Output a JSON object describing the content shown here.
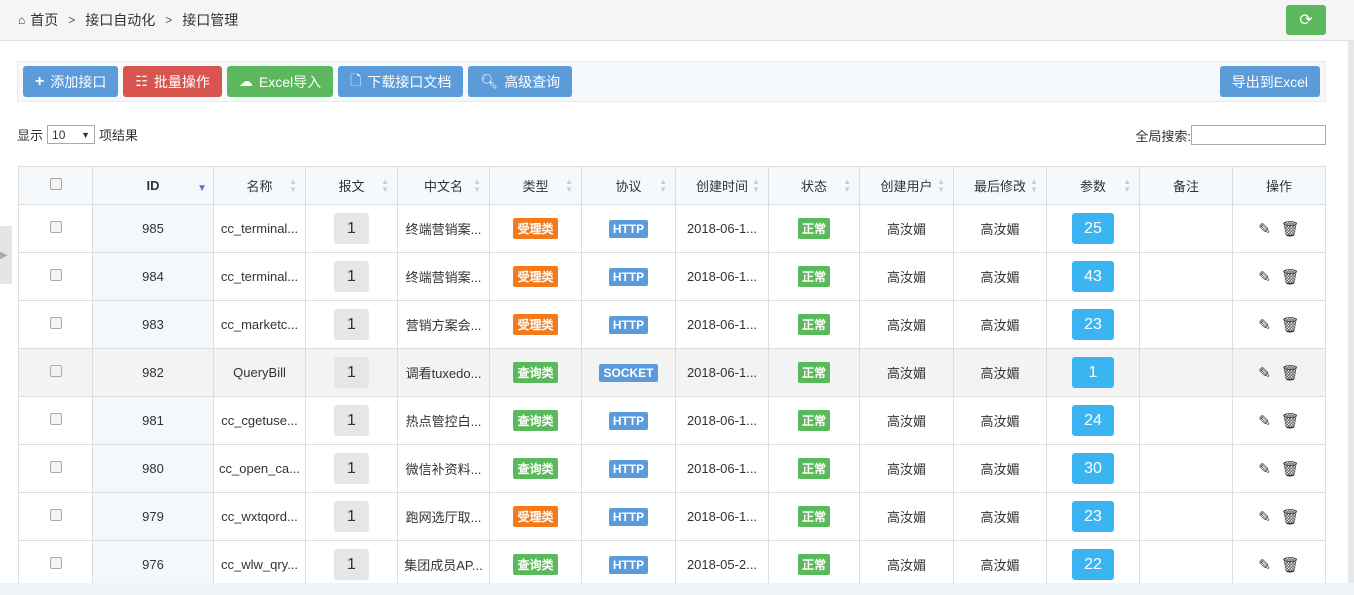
{
  "breadcrumb": {
    "home": "首页",
    "level2": "接口自动化",
    "level3": "接口管理",
    "separator": ">"
  },
  "toolbar": {
    "add": "添加接口",
    "batch": "批量操作",
    "excel_import": "Excel导入",
    "download_doc": "下载接口文档",
    "advanced_query": "高级查询",
    "export_excel": "导出到Excel"
  },
  "length": {
    "show": "显示",
    "value": "10",
    "suffix": "项结果"
  },
  "search": {
    "label": "全局搜索:",
    "value": ""
  },
  "colors": {
    "blue": "#5b9bd9",
    "red": "#d9534f",
    "green": "#5cb85c",
    "orange": "#f37b1d",
    "count": "#3bb4f2"
  },
  "columns": [
    "ID",
    "名称",
    "报文",
    "中文名",
    "类型",
    "协议",
    "创建时间",
    "状态",
    "创建用户",
    "最后修改",
    "参数",
    "备注",
    "操作"
  ],
  "rows": [
    {
      "id": "985",
      "name": "cc_terminal...",
      "msg": "1",
      "cn": "终端营销案...",
      "type": "受理类",
      "proto": "HTTP",
      "created": "2018-06-1...",
      "status": "正常",
      "user": "高汝媚",
      "modifier": "高汝媚",
      "params": "25",
      "note": ""
    },
    {
      "id": "984",
      "name": "cc_terminal...",
      "msg": "1",
      "cn": "终端营销案...",
      "type": "受理类",
      "proto": "HTTP",
      "created": "2018-06-1...",
      "status": "正常",
      "user": "高汝媚",
      "modifier": "高汝媚",
      "params": "43",
      "note": ""
    },
    {
      "id": "983",
      "name": "cc_marketc...",
      "msg": "1",
      "cn": "营销方案会...",
      "type": "受理类",
      "proto": "HTTP",
      "created": "2018-06-1...",
      "status": "正常",
      "user": "高汝媚",
      "modifier": "高汝媚",
      "params": "23",
      "note": ""
    },
    {
      "id": "982",
      "name": "QueryBill",
      "msg": "1",
      "cn": "调看tuxedo...",
      "type": "查询类",
      "proto": "SOCKET",
      "created": "2018-06-1...",
      "status": "正常",
      "user": "高汝媚",
      "modifier": "高汝媚",
      "params": "1",
      "note": ""
    },
    {
      "id": "981",
      "name": "cc_cgetuse...",
      "msg": "1",
      "cn": "热点管控白...",
      "type": "查询类",
      "proto": "HTTP",
      "created": "2018-06-1...",
      "status": "正常",
      "user": "高汝媚",
      "modifier": "高汝媚",
      "params": "24",
      "note": ""
    },
    {
      "id": "980",
      "name": "cc_open_ca...",
      "msg": "1",
      "cn": "微信补资料...",
      "type": "查询类",
      "proto": "HTTP",
      "created": "2018-06-1...",
      "status": "正常",
      "user": "高汝媚",
      "modifier": "高汝媚",
      "params": "30",
      "note": ""
    },
    {
      "id": "979",
      "name": "cc_wxtqord...",
      "msg": "1",
      "cn": "跑网选厅取...",
      "type": "受理类",
      "proto": "HTTP",
      "created": "2018-06-1...",
      "status": "正常",
      "user": "高汝媚",
      "modifier": "高汝媚",
      "params": "23",
      "note": ""
    },
    {
      "id": "976",
      "name": "cc_wlw_qry...",
      "msg": "1",
      "cn": "集团成员AP...",
      "type": "查询类",
      "proto": "HTTP",
      "created": "2018-05-2...",
      "status": "正常",
      "user": "高汝媚",
      "modifier": "高汝媚",
      "params": "22",
      "note": ""
    }
  ]
}
